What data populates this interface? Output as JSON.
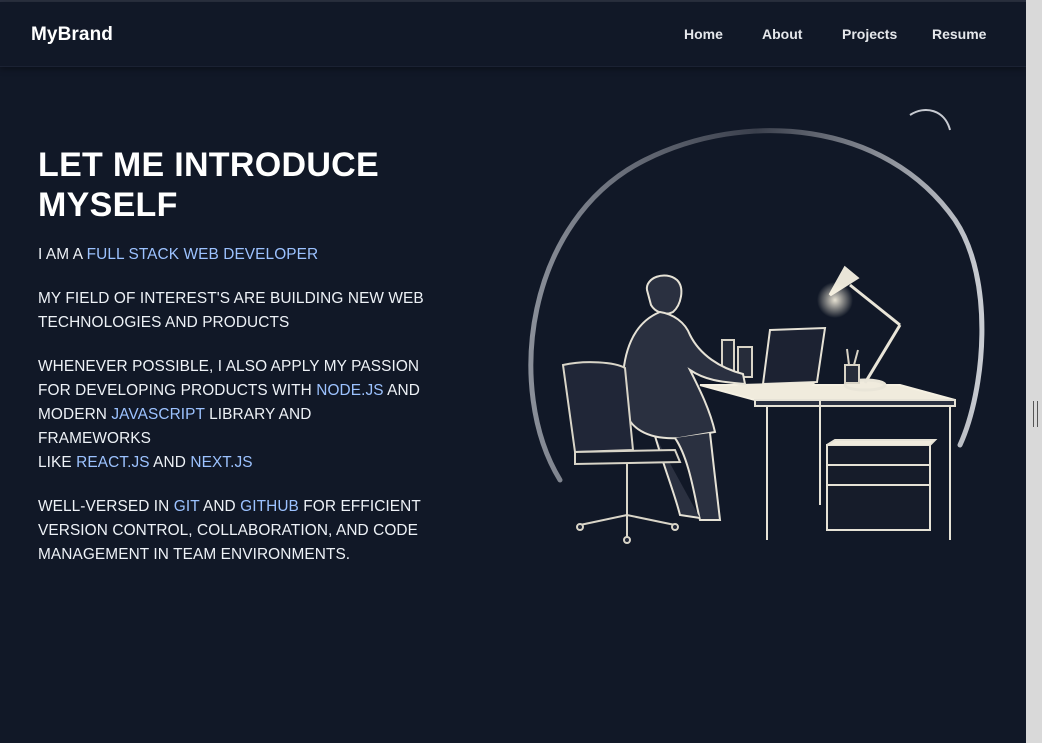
{
  "navbar": {
    "brand": "MyBrand",
    "links": [
      "Home",
      "About",
      "Projects",
      "Resume"
    ]
  },
  "hero": {
    "title_line1": "LET ME INTRODUCE",
    "title_line2": "MYSELF",
    "p1": {
      "t1": "I AM A ",
      "h1": "FULL STACK WEB DEVELOPER"
    },
    "p2": {
      "line1": "MY FIELD OF INTEREST'S ARE BUILDING NEW WEB",
      "line2": "TECHNOLOGIES AND PRODUCTS"
    },
    "p3": {
      "line1": "WHENEVER POSSIBLE, I ALSO APPLY MY PASSION",
      "t2": "FOR DEVELOPING PRODUCTS WITH ",
      "h2": "NODE.JS",
      "t3": " AND",
      "t4": "MODERN ",
      "h3": "JAVASCRIPT",
      "t5": " LIBRARY AND FRAMEWORKS",
      "t6": "LIKE ",
      "h4": "REACT.JS",
      "t7": " AND ",
      "h5": "NEXT.JS"
    },
    "p4": {
      "t1": "WELL-VERSED IN ",
      "h1": "GIT",
      "t2": " AND ",
      "h2": "GITHUB",
      "t3": " FOR EFFICIENT",
      "line2": "VERSION CONTROL, COLLABORATION, AND CODE",
      "line3": "MANAGEMENT IN TEAM ENVIRONMENTS."
    }
  },
  "illustration": {
    "icon": "developer-at-desk-illustration"
  },
  "colors": {
    "background": "#111827",
    "highlight": "#9cc2ff",
    "text": "#eef2f7"
  }
}
